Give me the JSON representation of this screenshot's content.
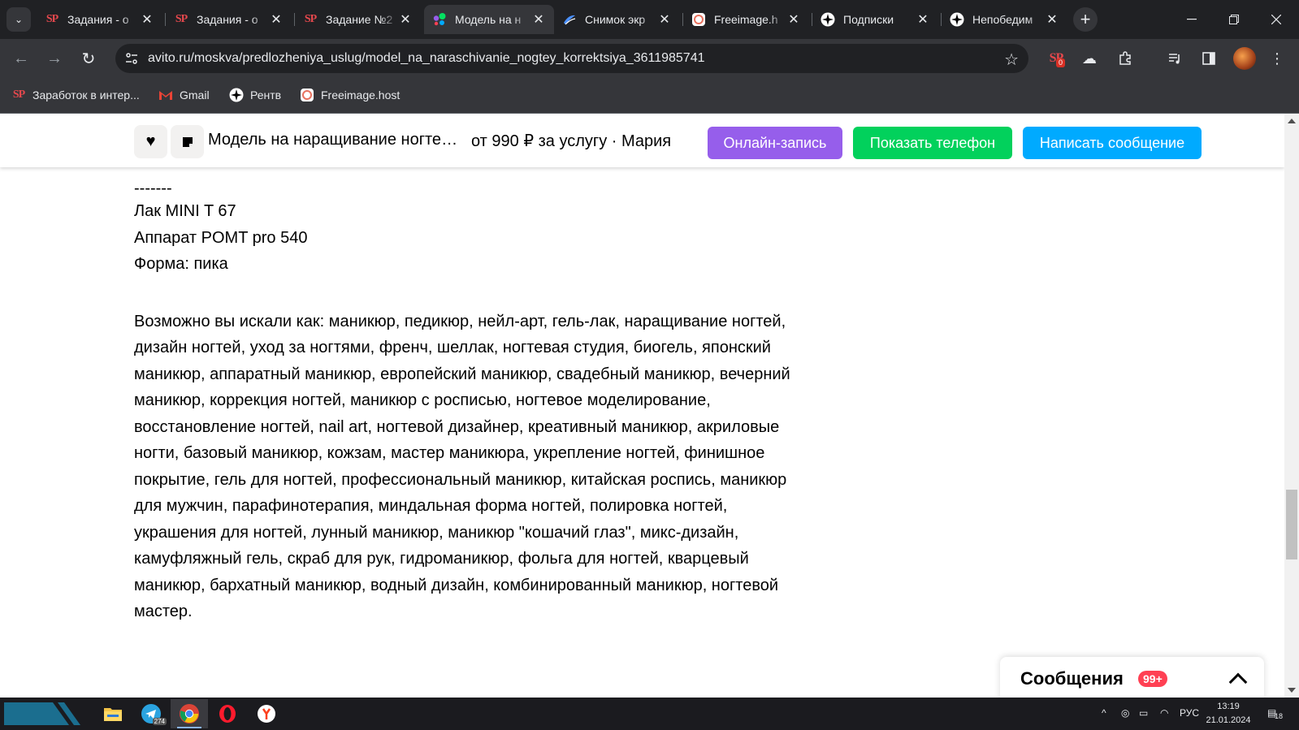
{
  "tabs": [
    {
      "label": "Задания - о",
      "favicon": "sp-logo",
      "active": false
    },
    {
      "label": "Задания - о",
      "favicon": "sp-logo",
      "active": false
    },
    {
      "label": "Задание №2",
      "favicon": "sp-logo",
      "active": false
    },
    {
      "label": "Модель на н",
      "favicon": "avito-logo",
      "active": true
    },
    {
      "label": "Снимок экр",
      "favicon": "screenshot-logo",
      "active": false
    },
    {
      "label": "Freeimage.h",
      "favicon": "freeimage-logo",
      "active": false
    },
    {
      "label": "Подписки",
      "favicon": "sparkle-icon",
      "active": false
    },
    {
      "label": "Непобедим",
      "favicon": "sparkle-icon",
      "active": false
    }
  ],
  "toolbar": {
    "url": "avito.ru/moskva/predlozheniya_uslug/model_na_naraschivanie_nogtey_korrektsiya_3611985741",
    "extension_badge": "0"
  },
  "bookmarks": [
    {
      "label": "Заработок в интер...",
      "icon": "sp-logo"
    },
    {
      "label": "Gmail",
      "icon": "gmail-icon"
    },
    {
      "label": "Рентв",
      "icon": "sparkle-icon"
    },
    {
      "label": "Freeimage.host",
      "icon": "freeimage-logo"
    }
  ],
  "sticky": {
    "title": "Модель на наращивание ногтей, коррекция",
    "price": "от 990 ₽ за услугу",
    "seller": "Мария",
    "online_booking": "Онлайн-запись",
    "show_phone": "Показать телефон",
    "write_message": "Написать сообщение"
  },
  "content": {
    "separator": "-------",
    "lines": [
      "Лак MINI T 67",
      "Аппарат POMT pro 540",
      "Форма: пика"
    ],
    "seo_text": "Возможно вы искали как: маникюр, педикюр, нейл-арт, гель-лак, наращивание ногтей, дизайн ногтей, уход за ногтями, френч, шеллак, ногтевая студия, биогель, японский маникюр, аппаратный маникюр, европейский маникюр, свадебный маникюр, вечерний маникюр, коррекция ногтей, маникюр с росписью, ногтевое моделирование, восстановление ногтей, nail art, ногтевой дизайнер, креативный маникюр, акриловые ногти, базовый маникюр, кожзам, мастер маникюра, укрепление ногтей, финишное покрытие, гель для ногтей, профессиональный маникюр, китайская роспись, маникюр для мужчин, парафинотерапия, миндальная форма ногтей, полировка ногтей, украшения для ногтей, лунный маникюр, маникюр \"кошачий глаз\", микс-дизайн, камуфляжный гель, скраб для рук, гидроманикюр, фольга для ногтей, кварцевый маникюр, бархатный маникюр, водный дизайн, комбинированный маникюр, ногтевой мастер."
  },
  "messages": {
    "title": "Сообщения",
    "badge": "99+"
  },
  "taskbar": {
    "telegram_badge": "274",
    "tray_lang": "РУС",
    "time": "13:19",
    "date": "21.01.2024",
    "notification_count": "18"
  },
  "colors": {
    "online_booking": "#965eeb",
    "show_phone": "#02d15c",
    "write_message": "#00aaff",
    "badge": "#ff4053"
  }
}
